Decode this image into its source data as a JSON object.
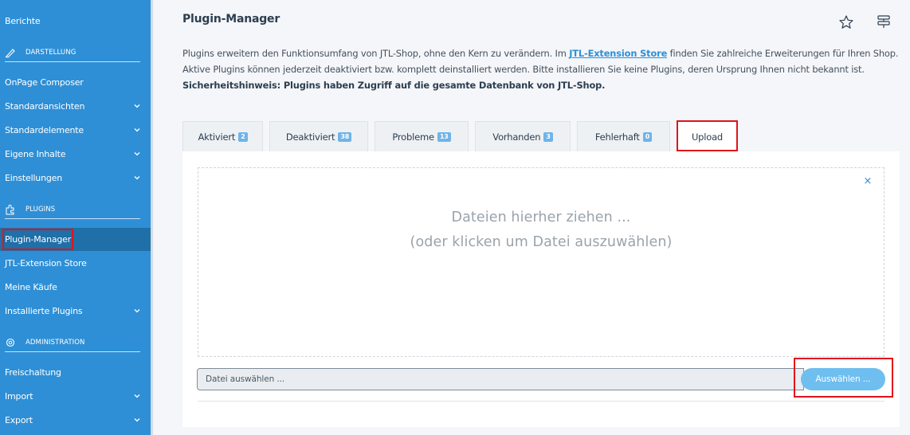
{
  "sidebar": {
    "top_item": "Berichte",
    "sections": {
      "darstellung": "DARSTELLUNG",
      "plugins": "PLUGINS",
      "administration": "ADMINISTRATION"
    },
    "items": [
      {
        "label": "OnPage Composer"
      },
      {
        "label": "Standardansichten"
      },
      {
        "label": "Standardelemente"
      },
      {
        "label": "Eigene Inhalte"
      },
      {
        "label": "Einstellungen"
      },
      {
        "label": "Plugin-Manager"
      },
      {
        "label": "JTL-Extension Store"
      },
      {
        "label": "Meine Käufe"
      },
      {
        "label": "Installierte Plugins"
      },
      {
        "label": "Freischaltung"
      },
      {
        "label": "Import"
      },
      {
        "label": "Export"
      }
    ],
    "colors": {
      "background": "#2e8fd6",
      "active": "#1f6fa8",
      "highlight": "#e0131b"
    }
  },
  "header": {
    "title": "Plugin-Manager",
    "favorite_icon": "star-icon",
    "settings_icon": "sliders-icon"
  },
  "intro": {
    "text1": "Plugins erweitern den Funktionsumfang von JTL-Shop, ohne den Kern zu verändern. Im ",
    "link": "JTL-Extension Store",
    "text2": " finden Sie zahlreiche Erweiterungen für Ihren Shop.",
    "line2": "Aktive Plugins können jederzeit deaktiviert bzw. komplett deinstalliert werden. Bitte installieren Sie keine Plugins, deren Ursprung Ihnen nicht bekannt ist.",
    "warning": "Sicherheitshinweis: Plugins haben Zugriff auf die gesamte Datenbank von JTL-Shop."
  },
  "tabs": [
    {
      "label": "Aktiviert",
      "count": "2"
    },
    {
      "label": "Deaktiviert",
      "count": "38"
    },
    {
      "label": "Probleme",
      "count": "13"
    },
    {
      "label": "Vorhanden",
      "count": "3"
    },
    {
      "label": "Fehlerhaft",
      "count": "0"
    },
    {
      "label": "Upload",
      "count": ""
    }
  ],
  "upload": {
    "drop_line1": "Dateien hierher ziehen ...",
    "drop_line2": "(oder klicken um Datei auszuwählen)",
    "close_symbol": "×",
    "file_placeholder": "Datei auswählen ...",
    "choose_button": "Auswählen ..."
  }
}
